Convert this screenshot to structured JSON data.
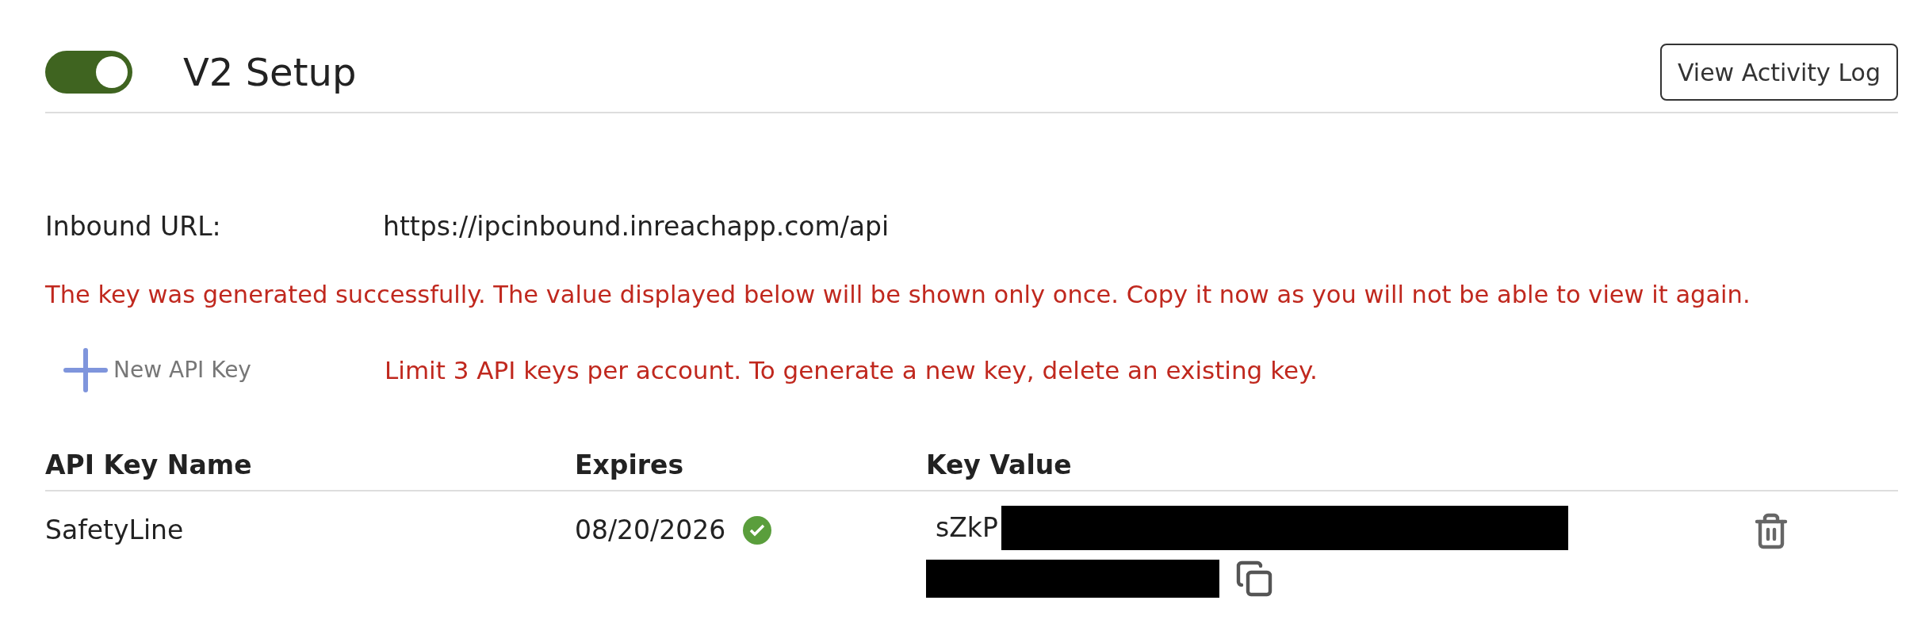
{
  "header": {
    "toggle": {
      "on": true
    },
    "title": "V2 Setup",
    "activity_button": "View Activity Log"
  },
  "inbound": {
    "label": "Inbound URL:",
    "value": "https://ipcinbound.inreachapp.com/api"
  },
  "success_message": "The key was generated successfully. The value displayed below will be shown only once. Copy it now as you will not be able to view it again.",
  "new_key_button": {
    "label": "New API Key",
    "disabled": true
  },
  "limit_message": "Limit 3 API keys per account. To generate a new key, delete an existing key.",
  "table": {
    "columns": [
      "API Key Name",
      "Expires",
      "Key Value"
    ],
    "rows": [
      {
        "name": "SafetyLine",
        "expires": "08/20/2026",
        "valid": true,
        "key_value": "sZkP"
      }
    ]
  }
}
